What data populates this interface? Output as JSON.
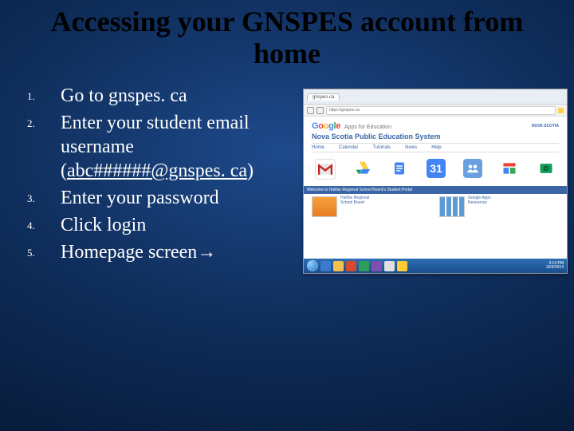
{
  "title": "Accessing your GNSPES account from home",
  "steps": [
    {
      "text": "Go to gnspes. ca"
    },
    {
      "text_prefix": "Enter your student email username ",
      "email": "abc######@gnspes. ca"
    },
    {
      "text": "Enter your password"
    },
    {
      "text": "Click login"
    },
    {
      "text": "Homepage screen",
      "arrow": "→"
    }
  ],
  "screenshot": {
    "browser_tab": "gnspes.ca",
    "address": "https://gnspes.ca",
    "google_label": "Google",
    "apps_suffix": "Apps for Education",
    "portal_title": "Nova Scotia Public Education System",
    "ns_label": "NOVA SCOTIA",
    "nav": [
      "Home",
      "Calendar",
      "Tutorials",
      "News",
      "Help"
    ],
    "calendar_number": "31",
    "welcome": "Welcome to Halifax Regional School Board's Student Portal",
    "taskbar_time": "3:14 PM",
    "taskbar_date": "10/6/2014"
  }
}
